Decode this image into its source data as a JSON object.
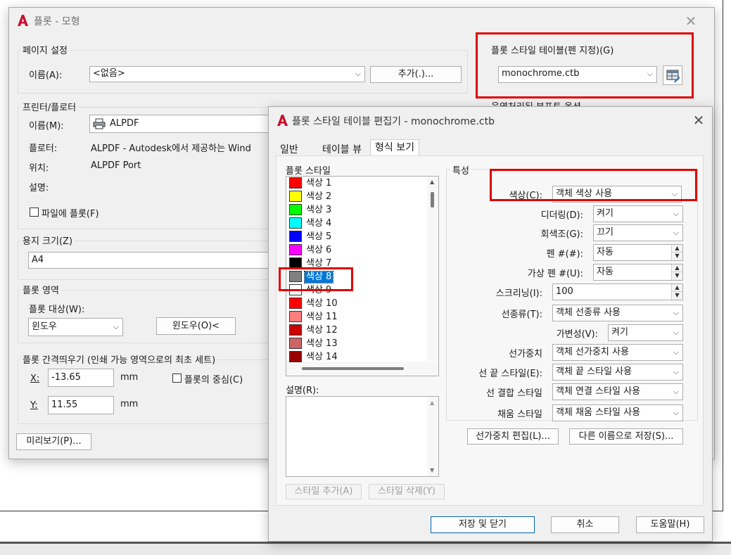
{
  "colors": {
    "red_highlight": "#e00000",
    "autocad_red": "#c8102e",
    "selection": "#0078d7"
  },
  "plot_dialog": {
    "title": "플롯 - 모형",
    "close_icon": "close-icon",
    "page_setup": {
      "group_label": "페이지 설정",
      "name_label": "이름(A):",
      "name_value": "<없음>",
      "add_button": "추가(.)..."
    },
    "style_table": {
      "group_label": "플롯 스타일 테이블(펜 지정)(G)",
      "value": "monochrome.ctb",
      "edit_icon": "edit-table-icon"
    },
    "shaded_label_partial": "음영처리된 뷰포트 옵션",
    "printer": {
      "group_label": "프린터/플로터",
      "name_label": "이름(M):",
      "name_value": "ALPDF",
      "plotter_label": "플로터:",
      "plotter_value": "ALPDF - Autodesk에서 제공하는 Wind",
      "where_label": "위치:",
      "where_value": "ALPDF Port",
      "desc_label": "설명:",
      "plot_to_file_label": "파일에 플롯(F)"
    },
    "paper_size": {
      "group_label": "용지 크기(Z)",
      "value": "A4"
    },
    "plot_area": {
      "group_label": "플롯 영역",
      "what_label": "플롯 대상(W):",
      "what_value": "윈도우",
      "window_button": "윈도우(O)<"
    },
    "plot_offset": {
      "group_label": "플롯 간격띄우기 (인쇄 가능 영역으로의 최초 세트)",
      "x_label": "X:",
      "x_value": "-13.65",
      "x_unit": "mm",
      "y_label": "Y:",
      "y_value": "11.55",
      "y_unit": "mm",
      "center_label": "플롯의 중심(C)"
    },
    "preview_button": "미리보기(P)..."
  },
  "editor": {
    "title": "플롯 스타일 테이블 편집기 - monochrome.ctb",
    "close_icon": "close-icon",
    "tabs": [
      "일반",
      "테이블 뷰",
      "형식 보기"
    ],
    "active_tab": 2,
    "styles_label": "플롯 스타일",
    "styles": [
      {
        "name": "색상 1",
        "color": "#ff0000"
      },
      {
        "name": "색상 2",
        "color": "#ffff00"
      },
      {
        "name": "색상 3",
        "color": "#00ff00"
      },
      {
        "name": "색상 4",
        "color": "#00ffff"
      },
      {
        "name": "색상 5",
        "color": "#0000ff"
      },
      {
        "name": "색상 6",
        "color": "#ff00ff"
      },
      {
        "name": "색상 7",
        "color": "#000000"
      },
      {
        "name": "색상 8",
        "color": "#808080"
      },
      {
        "name": "색상 9",
        "color": "#ffffff"
      },
      {
        "name": "색상 10",
        "color": "#ff0000"
      },
      {
        "name": "색상 11",
        "color": "#ff7f7f"
      },
      {
        "name": "색상 12",
        "color": "#cc0000"
      },
      {
        "name": "색상 13",
        "color": "#cc6666"
      },
      {
        "name": "색상 14",
        "color": "#990000"
      }
    ],
    "selected_style": 7,
    "description_label": "설명(R):",
    "add_style_button": "스타일 추가(A)",
    "delete_style_button": "스타일 삭제(Y)",
    "properties": {
      "group_label": "특성",
      "color_label": "색상(C):",
      "color_value": "객체 색상 사용",
      "dither_label": "디더링(D):",
      "dither_value": "켜기",
      "grayscale_label": "회색조(G):",
      "grayscale_value": "끄기",
      "pen_label": "펜 #(#):",
      "pen_value": "자동",
      "vpen_label": "가상 펜 #(U):",
      "vpen_value": "자동",
      "screening_label": "스크리닝(I):",
      "screening_value": "100",
      "linetype_label": "선종류(T):",
      "linetype_value": "객체 선종류 사용",
      "adaptive_label": "가변성(V):",
      "adaptive_value": "켜기",
      "lineweight_label": "선가중치",
      "lineweight_value": "객체 선가중치 사용",
      "lineend_label": "선 끝 스타일(E):",
      "lineend_value": "객체 끝 스타일 사용",
      "linejoin_label": "선 결합 스타일",
      "linejoin_value": "객체 연결 스타일 사용",
      "fill_label": "채움 스타일",
      "fill_value": "객체 채움 스타일 사용"
    },
    "edit_lineweights_button": "선가중치 편집(L)...",
    "save_as_button": "다른 이름으로 저장(S)...",
    "save_close_button": "저장 및 닫기",
    "cancel_button": "취소",
    "help_button": "도움말(H)"
  }
}
